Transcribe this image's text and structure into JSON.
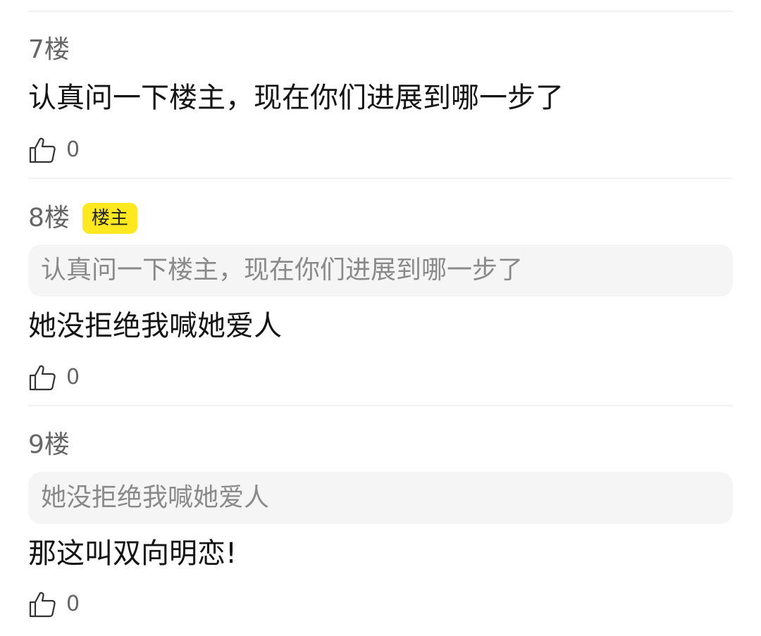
{
  "comments": [
    {
      "floor": "7楼",
      "content": "认真问一下楼主，现在你们进展到哪一步了",
      "likes": "0"
    },
    {
      "floor": "8楼",
      "badge": "楼主",
      "quote": "认真问一下楼主，现在你们进展到哪一步了",
      "content": "她没拒绝我喊她爱人",
      "likes": "0"
    },
    {
      "floor": "9楼",
      "quote": "她没拒绝我喊她爱人",
      "content": "那这叫双向明恋!",
      "likes": "0"
    }
  ],
  "icons": {
    "like": "thumbs-up-outline-icon"
  },
  "colors": {
    "op_badge": "#ffe81f",
    "quote_bg": "#f5f5f5",
    "divider": "#f2f2f2"
  }
}
